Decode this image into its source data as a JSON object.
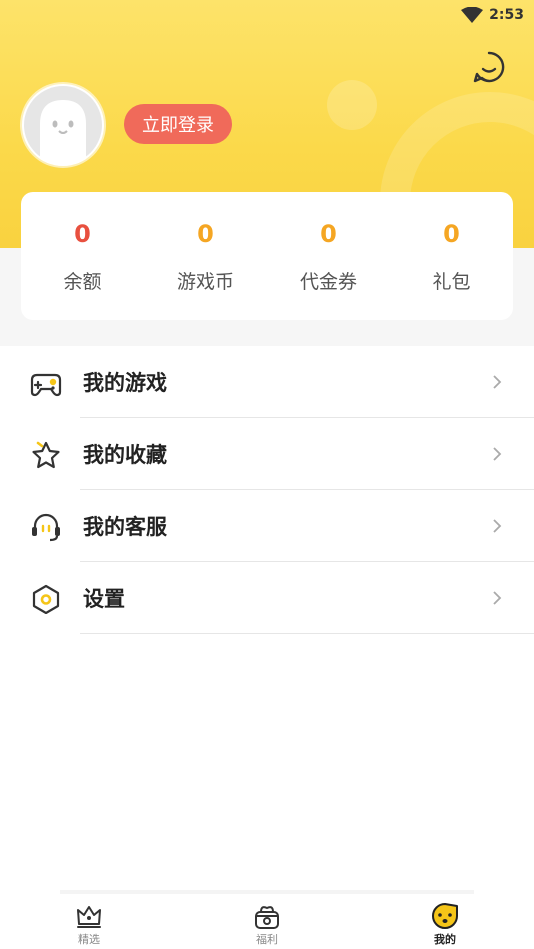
{
  "status_bar": {
    "time": "2:53"
  },
  "header": {
    "login_label": "立即登录"
  },
  "stats": [
    {
      "value": "0",
      "label": "余额"
    },
    {
      "value": "0",
      "label": "游戏币"
    },
    {
      "value": "0",
      "label": "代金券"
    },
    {
      "value": "0",
      "label": "礼包"
    }
  ],
  "menu": [
    {
      "label": "我的游戏",
      "icon": "gamepad-icon"
    },
    {
      "label": "我的收藏",
      "icon": "star-icon"
    },
    {
      "label": "我的客服",
      "icon": "headset-icon"
    },
    {
      "label": "设置",
      "icon": "hexagon-settings-icon"
    }
  ],
  "tabs": [
    {
      "label": "精选",
      "icon": "crown-icon",
      "active": false
    },
    {
      "label": "福利",
      "icon": "gift-icon",
      "active": false
    },
    {
      "label": "我的",
      "icon": "face-icon",
      "active": true
    }
  ],
  "colors": {
    "header": "#fbd94a",
    "accent": "#f5a623",
    "balance": "#e8503f",
    "login": "#f06a5a"
  }
}
